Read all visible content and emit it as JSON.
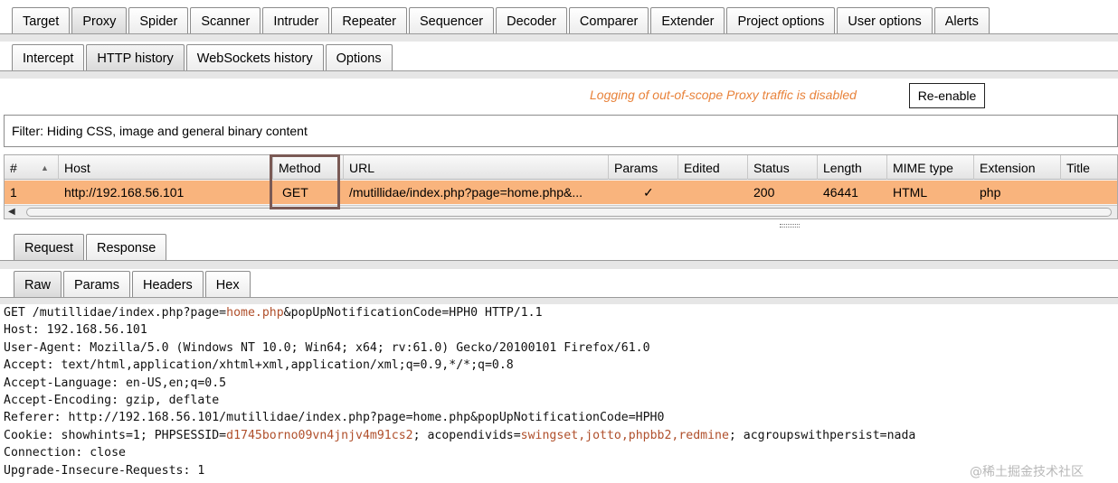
{
  "main_tabs": [
    "Target",
    "Proxy",
    "Spider",
    "Scanner",
    "Intruder",
    "Repeater",
    "Sequencer",
    "Decoder",
    "Comparer",
    "Extender",
    "Project options",
    "User options",
    "Alerts"
  ],
  "main_tabs_active": "Proxy",
  "proxy_tabs": [
    "Intercept",
    "HTTP history",
    "WebSockets history",
    "Options"
  ],
  "proxy_tabs_active": "HTTP history",
  "logging": {
    "message": "Logging of out-of-scope Proxy traffic is disabled",
    "button_label": "Re-enable"
  },
  "filter": {
    "text": "Filter: Hiding CSS, image and general binary content"
  },
  "table": {
    "columns": [
      "#",
      "Host",
      "Method",
      "URL",
      "Params",
      "Edited",
      "Status",
      "Length",
      "MIME type",
      "Extension",
      "Title"
    ],
    "rows": [
      {
        "num": "1",
        "host": "http://192.168.56.101",
        "method": "GET",
        "url": "/mutillidae/index.php?page=home.php&...",
        "params": "✓",
        "edited": "",
        "status": "200",
        "length": "46441",
        "mime": "HTML",
        "extension": "php",
        "title": ""
      }
    ],
    "selected_row_color": "#f9b47d"
  },
  "message_tabs": [
    "Request",
    "Response"
  ],
  "message_tabs_active": "Request",
  "view_tabs": [
    "Raw",
    "Params",
    "Headers",
    "Hex"
  ],
  "view_tabs_active": "Raw",
  "request": {
    "line1": {
      "before": "GET /mutillidae/index.php?page=",
      "param1": "home.php",
      "mid": "&popUpNotificationCode=",
      "param2": "HPH0",
      "after": " HTTP/1.1"
    },
    "host": "Host: 192.168.56.101",
    "user_agent": "User-Agent: Mozilla/5.0 (Windows NT 10.0; Win64; x64; rv:61.0) Gecko/20100101 Firefox/61.0",
    "accept": "Accept: text/html,application/xhtml+xml,application/xml;q=0.9,*/*;q=0.8",
    "accept_language": "Accept-Language: en-US,en;q=0.5",
    "accept_encoding": "Accept-Encoding: gzip, deflate",
    "referer": "Referer: http://192.168.56.101/mutillidae/index.php?page=home.php&popUpNotificationCode=HPH0",
    "cookie": {
      "prefix": "Cookie: showhints=1; PHPSESSID=",
      "sessid": "d1745borno09vn4jnjv4m91cs2",
      "mid": "; acopendivids=",
      "divids": "swingset,jotto,phpbb2,redmine",
      "suffix": "; acgroupswithpersist=nada"
    },
    "connection": "Connection: close",
    "upgrade": "Upgrade-Insecure-Requests: 1"
  },
  "watermark": "@稀土掘金技术社区",
  "colors": {
    "accent_orange": "#e8823a",
    "highlight_border": "#7a5a55",
    "param_value": "#b0502c"
  }
}
